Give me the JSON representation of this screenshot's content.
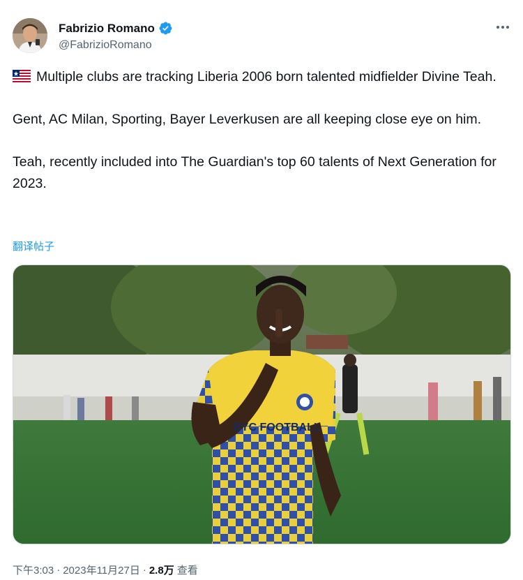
{
  "author": {
    "display_name": "Fabrizio Romano",
    "handle": "@FabrizioRomano",
    "verified": true
  },
  "tweet": {
    "paragraphs": [
      "Multiple clubs are tracking Liberia 2006 born talented midfielder Divine Teah.",
      "Gent, AC Milan, Sporting, Bayer Leverkusen are all keeping close eye on him.",
      "Teah, recently included into The Guardian's top 60 talents of Next Generation for 2023."
    ],
    "translate_label": "翻译帖子"
  },
  "media": {
    "jersey_text": "BYC FOOTBALL"
  },
  "meta": {
    "time": "下午3:03",
    "date": "2023年11月27日",
    "views_count": "2.8万",
    "views_label": "查看",
    "separator": "·"
  },
  "colors": {
    "link": "#1d9bf0",
    "verified": "#1d9bf0",
    "secondary_text": "#536471",
    "jersey_yellow": "#f2d23a",
    "jersey_blue": "#2f4fa8"
  },
  "icons": {
    "flag": "liberia-flag-icon",
    "verified": "verified-badge-icon",
    "more": "more-options-icon"
  }
}
